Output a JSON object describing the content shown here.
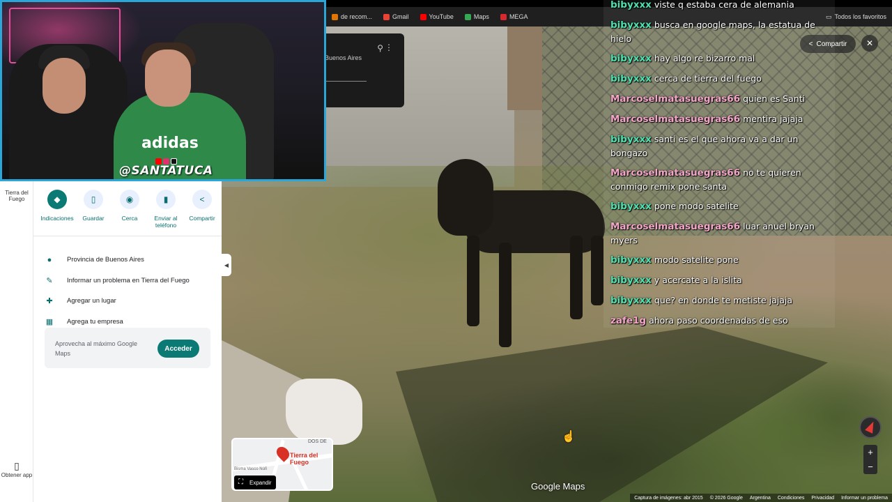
{
  "bookmarks": {
    "items": [
      {
        "label": "de recom...",
        "icon": "bookmark-icon",
        "color": "#e37400"
      },
      {
        "label": "Gmail",
        "icon": "gmail-icon",
        "color": "#ea4335"
      },
      {
        "label": "YouTube",
        "icon": "youtube-icon",
        "color": "#ff0000"
      },
      {
        "label": "Maps",
        "icon": "maps-icon",
        "color": "#34a853"
      },
      {
        "label": "MEGA",
        "icon": "mega-icon",
        "color": "#d9272e"
      }
    ],
    "all_favorites": "Todos los favoritos"
  },
  "search_panel": {
    "place_text": "Buenos Aires"
  },
  "rail": {
    "place_label": "Tierra del Fuego",
    "get_app_label": "Obtener app"
  },
  "actions": [
    {
      "label": "Indicaciones",
      "icon": "directions-icon"
    },
    {
      "label": "Guardar",
      "icon": "bookmark-icon"
    },
    {
      "label": "Cerca",
      "icon": "nearby-icon"
    },
    {
      "label": "Enviar al teléfono",
      "icon": "phone-icon"
    },
    {
      "label": "Compartir",
      "icon": "share-icon"
    }
  ],
  "info": [
    {
      "label": "Provincia de Buenos Aires",
      "icon": "location-pin-icon"
    },
    {
      "label": "Informar un problema en Tierra del Fuego",
      "icon": "pencil-icon"
    },
    {
      "label": "Agregar un lugar",
      "icon": "add-place-icon"
    },
    {
      "label": "Agrega tu empresa",
      "icon": "add-business-icon"
    }
  ],
  "promo": {
    "text": "Aprovecha al máximo Google Maps",
    "button": "Acceder"
  },
  "minimap": {
    "label": "Tierra del Fuego",
    "street_top": "DOS DE",
    "streets": "Bisma   Vasco Núñ",
    "expand": "Expandir"
  },
  "streetview": {
    "share": "Compartir",
    "logo": "Google Maps",
    "footer": [
      "Captura de imágenes: abr 2015",
      "© 2026 Google",
      "Argentina",
      "Condiciones",
      "Privacidad",
      "Informar un problema"
    ]
  },
  "chat": [
    {
      "user": "bibyxxx",
      "color": "#4fe0b0",
      "text": "viste q estaba cera de alemania"
    },
    {
      "user": "bibyxxx",
      "color": "#4fe0b0",
      "text": "busca en google maps, la estatua de hielo"
    },
    {
      "user": "bibyxxx",
      "color": "#4fe0b0",
      "text": "hay algo re bizarro mal"
    },
    {
      "user": "bibyxxx",
      "color": "#4fe0b0",
      "text": "cerca de tierra del fuego"
    },
    {
      "user": "Marcoselmatasuegras66",
      "color": "#f3a6c8",
      "text": "quien es Santi"
    },
    {
      "user": "Marcoselmatasuegras66",
      "color": "#f3a6c8",
      "text": "mentira jajaja"
    },
    {
      "user": "bibyxxx",
      "color": "#4fe0b0",
      "text": "santi es el que ahora va a dar un bongazo"
    },
    {
      "user": "Marcoselmatasuegras66",
      "color": "#f3a6c8",
      "text": "no te quieren conmigo remix pone santa"
    },
    {
      "user": "bibyxxx",
      "color": "#4fe0b0",
      "text": "pone modo satelite"
    },
    {
      "user": "Marcoselmatasuegras66",
      "color": "#f3a6c8",
      "text": "luar anuel bryan myers"
    },
    {
      "user": "bibyxxx",
      "color": "#4fe0b0",
      "text": "modo satelite pone"
    },
    {
      "user": "bibyxxx",
      "color": "#4fe0b0",
      "text": "y acercate a la islita"
    },
    {
      "user": "bibyxxx",
      "color": "#4fe0b0",
      "text": "que? en donde te metiste jajaja"
    },
    {
      "user": "zafe1g",
      "color": "#f3a6c8",
      "text": "ahora paso coordenadas de eso"
    }
  ],
  "webcam": {
    "handle": "@SANTATUCA",
    "shirt": "adidas"
  }
}
